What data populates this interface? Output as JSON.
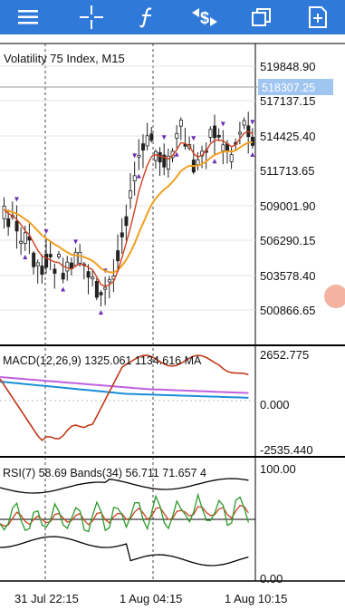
{
  "toolbar": {
    "icons": [
      "menu-icon",
      "crosshair-icon",
      "indicators-icon",
      "trade-icon",
      "windows-icon",
      "new-order-icon"
    ],
    "background": "#2f79d8"
  },
  "chart": {
    "symbol_title": "Volatility 75 Index, M15",
    "price_scale": [
      "519848.90",
      "517137.15",
      "514425.40",
      "511713.65",
      "509001.90",
      "506290.15",
      "503578.40",
      "500866.65"
    ],
    "current_price": "518307.25",
    "macd": {
      "label": "MACD(12,26,9) 1325.061 1134.616 MA",
      "scale": [
        "2652.775",
        "0.000",
        "-2535.440"
      ]
    },
    "rsi": {
      "label": "RSI(7) 58.69 Bands(34) 56.711 71.657 4",
      "scale": [
        "100.00",
        "0.00"
      ]
    },
    "time_axis": [
      "31 Jul 22:15",
      "1 Aug 04:15",
      "1 Aug 10:15"
    ],
    "colors": {
      "bull": "#ffffff",
      "bear": "#222222",
      "ema_fast": "#d04020",
      "ema_slow": "#f0a020",
      "fractal": "#6a2bb0",
      "macd_main": "#1a8fd8",
      "macd_signal": "#c060e0",
      "macd_osc": "#c03a1a",
      "badge": "#9fc5f0"
    }
  }
}
